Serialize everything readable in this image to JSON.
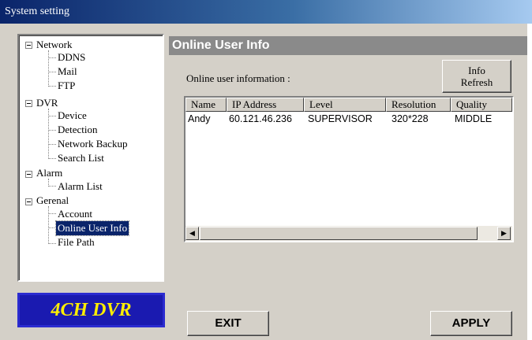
{
  "window": {
    "title": "System setting"
  },
  "tree": {
    "groups": [
      {
        "label": "Network",
        "items": [
          "DDNS",
          "Mail",
          "FTP"
        ]
      },
      {
        "label": "DVR",
        "items": [
          "Device",
          "Detection",
          "Network Backup",
          "Search List"
        ]
      },
      {
        "label": "Alarm",
        "items": [
          "Alarm List"
        ]
      },
      {
        "label": "Gerenal",
        "items": [
          "Account",
          "Online User Info",
          "File Path"
        ]
      }
    ],
    "selected": "Online User Info"
  },
  "logo": {
    "text": "4CH DVR"
  },
  "main": {
    "header": "Online User Info",
    "label": "Online user information :",
    "refresh_button": {
      "line1": "Info",
      "line2": "Refresh"
    },
    "table": {
      "columns": [
        "Name",
        "IP Address",
        "Level",
        "Resolution",
        "Quality"
      ],
      "rows": [
        [
          "Andy",
          "60.121.46.236",
          "SUPERVISOR",
          "320*228",
          "MIDDLE"
        ]
      ]
    }
  },
  "buttons": {
    "exit": "EXIT",
    "apply": "APPLY"
  },
  "icons": {
    "scroll_left": "scroll-left-arrow-icon",
    "scroll_right": "scroll-right-arrow-icon",
    "expander": "minus-box-icon"
  }
}
